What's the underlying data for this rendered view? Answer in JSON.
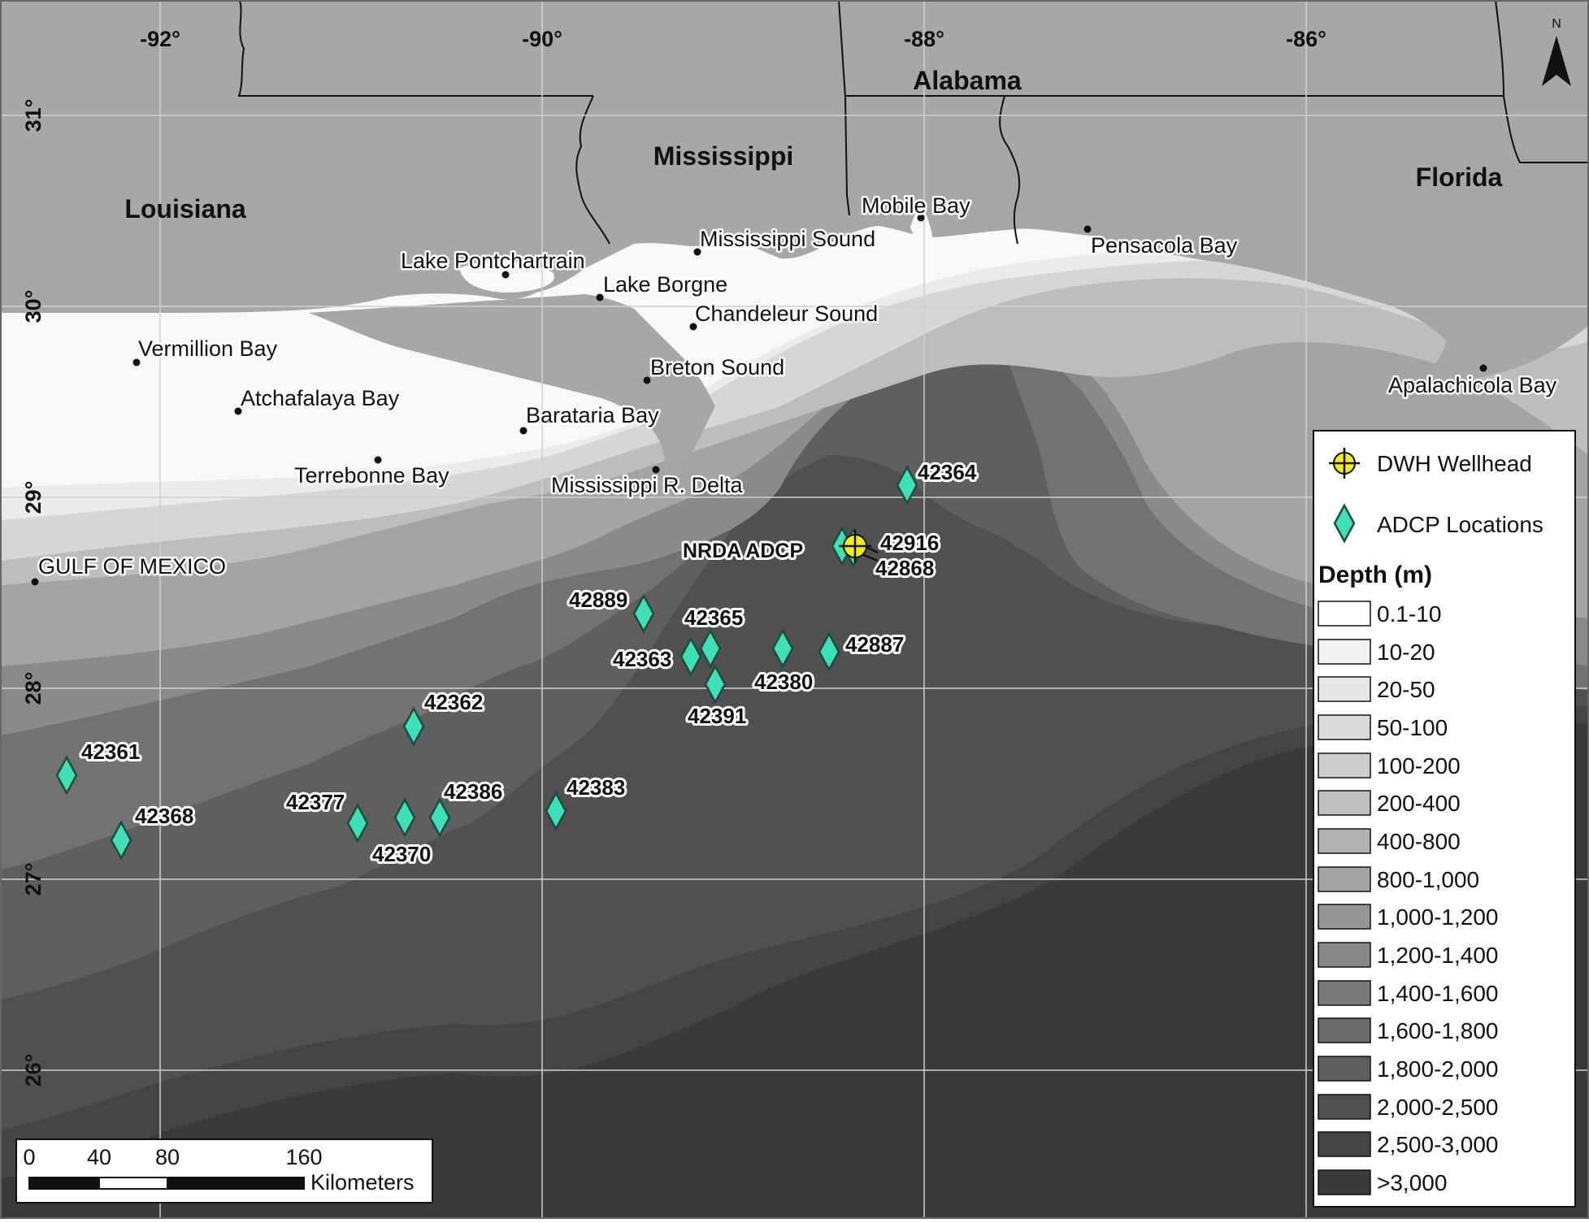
{
  "map": {
    "gridLongitudes": [
      "-92°",
      "-90°",
      "-88°",
      "-86°"
    ],
    "gridLatitudes": [
      "31°",
      "30°",
      "29°",
      "28°",
      "27°",
      "26°"
    ],
    "northArrow": "N",
    "states": [
      "Louisiana",
      "Mississippi",
      "Alabama",
      "Florida"
    ],
    "places": [
      "Mobile Bay",
      "Mississippi Sound",
      "Lake Pontchartrain",
      "Lake Borgne",
      "Chandeleur Sound",
      "Pensacola Bay",
      "Vermillion Bay",
      "Breton Sound",
      "Atchafalaya Bay",
      "Barataria Bay",
      "Terrebonne Bay",
      "Mississippi R. Delta",
      "GULF OF MEXICO",
      "Apalachicola Bay"
    ],
    "stations": [
      "42364",
      "42916",
      "42868",
      "42889",
      "42365",
      "42363",
      "42380",
      "42887",
      "42391",
      "42362",
      "42361",
      "42368",
      "42377",
      "42370",
      "42386",
      "42383"
    ],
    "nrdaLabel": "NRDA ADCP"
  },
  "legend": {
    "wellhead": "DWH Wellhead",
    "adcp": "ADCP Locations",
    "depthTitle": "Depth (m)",
    "depthClasses": [
      "0.1-10",
      "10-20",
      "20-50",
      "50-100",
      "100-200",
      "200-400",
      "400-800",
      "800-1,000",
      "1,000-1,200",
      "1,200-1,400",
      "1,400-1,600",
      "1,600-1,800",
      "1,800-2,000",
      "2,000-2,500",
      "2,500-3,000",
      ">3,000"
    ]
  },
  "scaleBar": {
    "ticks": [
      "0",
      "40",
      "80",
      "160"
    ],
    "units": "Kilometers"
  }
}
